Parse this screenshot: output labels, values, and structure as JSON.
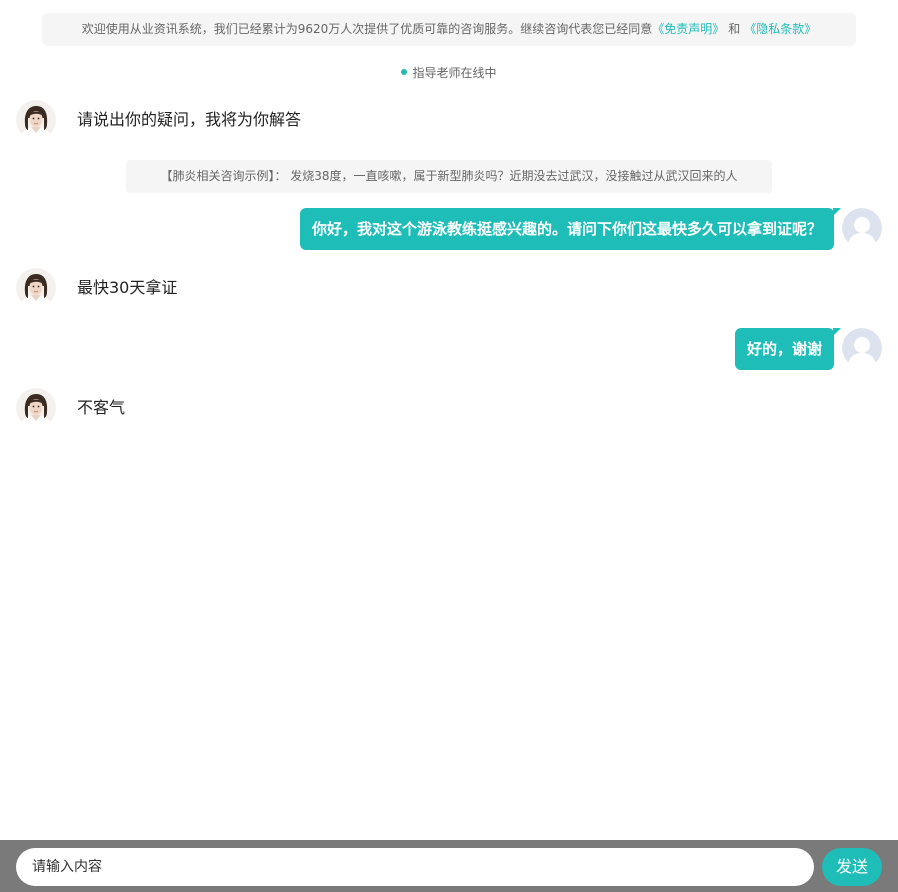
{
  "notice": {
    "text": "欢迎使用从业资讯系统，我们已经累计为9620万人次提供了优质可靠的咨询服务。继续咨询代表您已经同意",
    "disclaimer_link": "《免责声明》",
    "and": "和",
    "privacy_link": "《隐私条款》"
  },
  "status": {
    "text": "指导老师在线中",
    "dot_color": "#1fbdb8"
  },
  "messages": [
    {
      "sender": "bot",
      "text": "请说出你的疑问，我将为你解答"
    },
    {
      "sender": "system",
      "text": "【肺炎相关咨询示例】：  发烧38度，一直咳嗽，属于新型肺炎吗？近期没去过武汉，没接触过从武汉回来的人"
    },
    {
      "sender": "user",
      "text": "你好，我对这个游泳教练挺感兴趣的。请问下你们这最快多久可以拿到证呢？"
    },
    {
      "sender": "bot",
      "text": "最快30天拿证"
    },
    {
      "sender": "user",
      "text": "好的，谢谢"
    },
    {
      "sender": "bot",
      "text": "不客气"
    }
  ],
  "input": {
    "placeholder": "请输入内容",
    "value": ""
  },
  "send_button": {
    "label": "发送"
  },
  "icons": {
    "bot_avatar": "advisor-avatar-icon",
    "user_avatar": "user-avatar-icon"
  },
  "colors": {
    "accent": "#1fbdb8",
    "input_bar": "#7a7a7a",
    "notice_bg": "#f5f5f5"
  }
}
